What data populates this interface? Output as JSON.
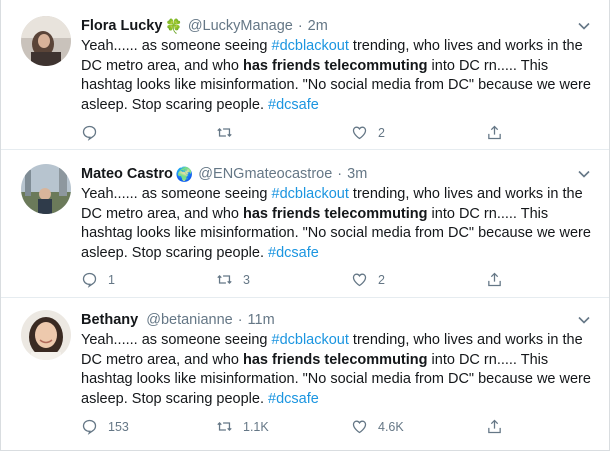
{
  "tweets": [
    {
      "name": "Flora Lucky",
      "badge": "🍀",
      "handle": "@LuckyManage",
      "time": "2m",
      "text_parts": {
        "p1": "Yeah...... as someone seeing ",
        "tag1": "#dcblackout",
        "p2": " trending, who lives and works in the DC metro area, and who ",
        "bold": "has friends telecommuting",
        "p3": " into DC rn..... This hashtag looks like misinformation. \"No social media from DC\" because we were asleep. Stop scaring people. ",
        "tag2": "#dcsafe"
      },
      "replies": "",
      "retweets": "",
      "likes": "2"
    },
    {
      "name": "Mateo Castro",
      "badge": "🌍",
      "handle": "@ENGmateocastroe",
      "time": "3m",
      "text_parts": {
        "p1": "Yeah...... as someone seeing ",
        "tag1": "#dcblackout",
        "p2": " trending, who lives and works in the DC metro area, and who ",
        "bold": "has friends telecommuting",
        "p3": " into DC rn..... This hashtag looks like misinformation. \"No social media from DC\" because we were asleep. Stop scaring people. ",
        "tag2": "#dcsafe"
      },
      "replies": "1",
      "retweets": "3",
      "likes": "2"
    },
    {
      "name": "Bethany",
      "badge": "",
      "handle": "@betanianne",
      "time": "11m",
      "text_parts": {
        "p1": "Yeah...... as someone seeing ",
        "tag1": "#dcblackout",
        "p2": " trending, who lives and works in the DC metro area, and who ",
        "bold": "has friends telecommuting",
        "p3": " into DC rn..... This hashtag looks like misinformation. \"No social media from DC\" because we were asleep. Stop scaring people. ",
        "tag2": "#dcsafe"
      },
      "replies": "153",
      "retweets": "1.1K",
      "likes": "4.6K"
    }
  ],
  "colors": {
    "link": "#1b95e0",
    "secondary": "#657786",
    "text": "#14171a"
  },
  "icons": [
    "reply-icon",
    "retweet-icon",
    "like-icon",
    "share-icon",
    "chevron-down-icon"
  ]
}
